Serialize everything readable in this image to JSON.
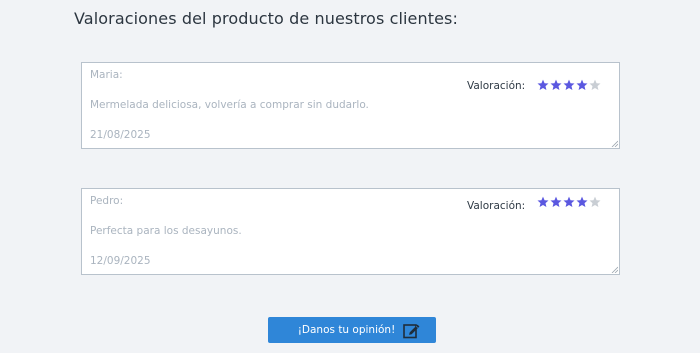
{
  "page": {
    "title": "Valoraciones del producto de nuestros clientes:"
  },
  "colors": {
    "background": "#f1f3f6",
    "card_border": "#b8c2cc",
    "placeholder_text": "#aab4bf",
    "star_filled": "#5b58e0",
    "star_empty": "#c9ced4",
    "button": "#2f86d8"
  },
  "rating_label": "Valoración:",
  "reviews": [
    {
      "author": "Maria:",
      "text": "Mermelada deliciosa, volvería a comprar sin dudarlo.",
      "date": "21/08/2025",
      "rating": 4,
      "max_rating": 5
    },
    {
      "author": "Pedro:",
      "text": "Perfecta para los desayunos.",
      "date": "12/09/2025",
      "rating": 4,
      "max_rating": 5
    }
  ],
  "cta": {
    "label": "¡Danos tu opinión!",
    "icon": "edit-icon"
  }
}
